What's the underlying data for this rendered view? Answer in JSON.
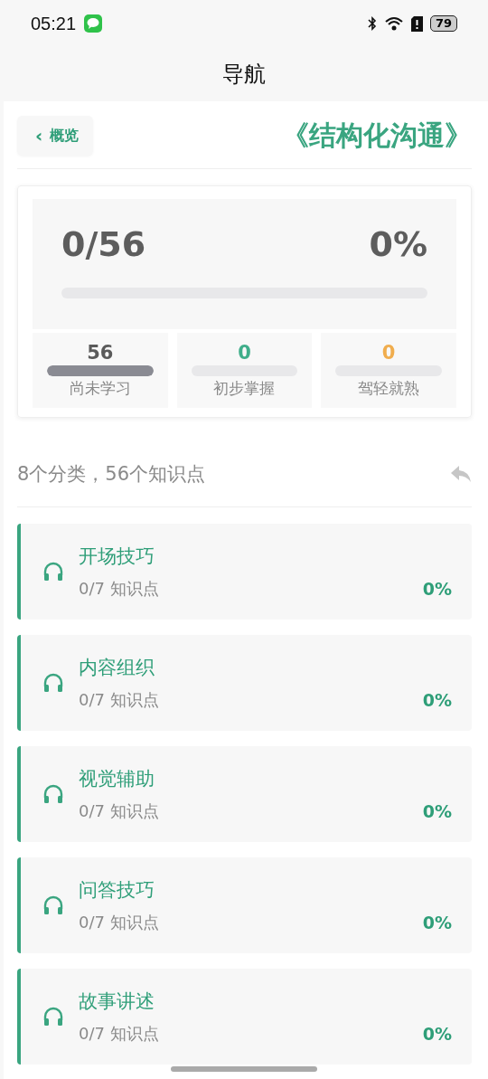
{
  "status_bar": {
    "time": "05:21",
    "battery": "79"
  },
  "header": {
    "title": "导航"
  },
  "top_bar": {
    "back_label": "概览",
    "back_icon": "‹",
    "book_title": "《结构化沟通》"
  },
  "summary": {
    "count": "0/56",
    "percent": "0%",
    "level": 0
  },
  "stats": [
    {
      "value": "56",
      "label": "尚未学习",
      "level": 1,
      "color": "#5a5a5a"
    },
    {
      "value": "0",
      "label": "初步掌握",
      "level": 0,
      "color": "#3fae8a"
    },
    {
      "value": "0",
      "label": "驾轻就熟",
      "level": 0,
      "color": "#f0ad4e"
    }
  ],
  "list_header": {
    "text": "8个分类，56个知识点"
  },
  "categories": [
    {
      "title": "开场技巧",
      "progress": "0/7 知识点",
      "percent": "0%"
    },
    {
      "title": "内容组织",
      "progress": "0/7 知识点",
      "percent": "0%"
    },
    {
      "title": "视觉辅助",
      "progress": "0/7 知识点",
      "percent": "0%"
    },
    {
      "title": "问答技巧",
      "progress": "0/7 知识点",
      "percent": "0%"
    },
    {
      "title": "故事讲述",
      "progress": "0/7 知识点",
      "percent": "0%"
    }
  ]
}
